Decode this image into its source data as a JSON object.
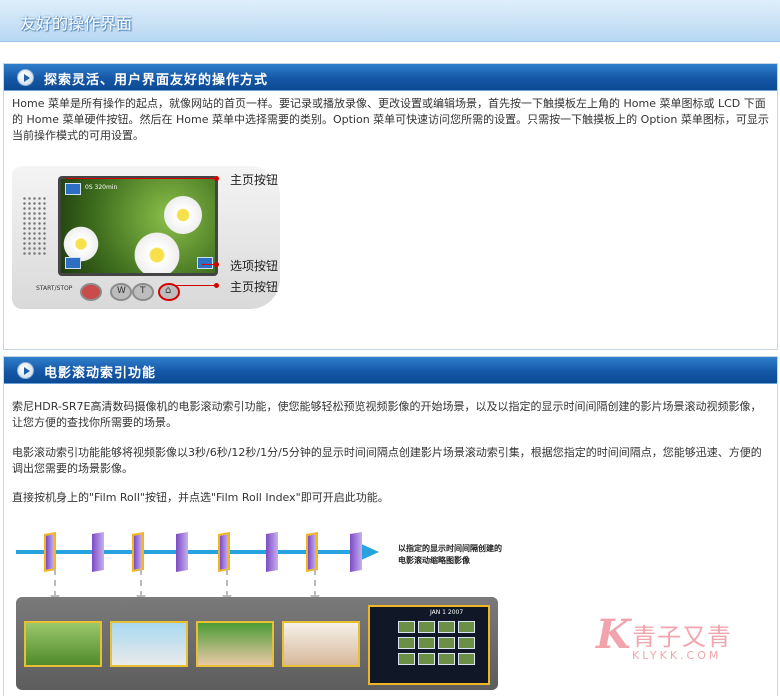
{
  "header": {
    "title": "友好的操作界面"
  },
  "section1": {
    "title": "探索灵活、用户界面友好的操作方式",
    "body": "Home 菜单是所有操作的起点，就像网站的首页一样。要记录或播放录像、更改设置或编辑场景，首先按一下触摸板左上角的 Home 菜单图标或 LCD 下面的 Home 菜单硬件按钮。然后在 Home 菜单中选择需要的类别。Option 菜单可快速访问您所需的设置。只需按一下触摸板上的 Option 菜单图标，可显示当前操作模式的可用设置。",
    "camera": {
      "labels": [
        "主页按钮",
        "选项按钮",
        "主页按钮"
      ],
      "screen_text": "0S 320min",
      "button_label": "START/STOP",
      "buttons": [
        "W",
        "T"
      ],
      "accent_color": "#d40000"
    }
  },
  "section2": {
    "title": "电影滚动索引功能",
    "paragraphs": [
      "索尼HDR-SR7E高清数码摄像机的电影滚动索引功能，使您能够轻松预览视频影像的开始场景，以及以指定的显示时间间隔创建的影片场景滚动视频影像，让您方便的查找你所需要的场景。",
      "电影滚动索引功能能够将视频影像以3秒/6秒/12秒/1分/5分钟的显示时间间隔点创建影片场景滚动索引集，根据您指定的时间间隔点，您能够迅速、方便的调出您需要的场景影像。",
      "直接按机身上的\"Film Roll\"按钮，并点选\"Film Roll Index\"即可开启此功能。"
    ],
    "film_note": [
      "以指定的显示时间间隔创建的",
      "电影滚动缩略图影像"
    ],
    "lcd_header": "JAN 1 2007",
    "film_color": "#29a3e0",
    "frame_highlight_color": "#f0b522"
  },
  "watermark": {
    "cn": "青子又青",
    "en": "KLYKK.COM",
    "logo": "K",
    "color": "#f0a6ad"
  }
}
